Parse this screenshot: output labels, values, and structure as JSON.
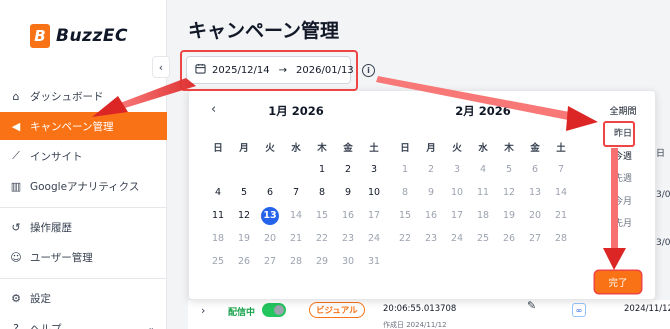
{
  "brand": {
    "logo_letter": "B",
    "name": "BuzzEC"
  },
  "sidebar": {
    "collapse": "‹",
    "items": [
      {
        "label": "ダッシュボード",
        "icon": "home-icon"
      },
      {
        "label": "キャンペーン管理",
        "icon": "megaphone-icon",
        "active": true
      },
      {
        "label": "インサイト",
        "icon": "trend-chart-icon"
      },
      {
        "label": "Googleアナリティクス",
        "icon": "bar-chart-icon"
      },
      {
        "label": "操作履歴",
        "icon": "history-icon"
      },
      {
        "label": "ユーザー管理",
        "icon": "users-icon"
      },
      {
        "label": "設定",
        "icon": "gear-icon"
      },
      {
        "label": "ヘルプ",
        "icon": "help-icon"
      }
    ]
  },
  "main": {
    "title": "キャンペーン管理",
    "date_range": {
      "start": "2025/12/14",
      "arrow": "→",
      "end": "2026/01/13"
    }
  },
  "picker": {
    "weekdays": [
      "日",
      "月",
      "火",
      "水",
      "木",
      "金",
      "土"
    ],
    "prev": "‹",
    "months": [
      {
        "title": "1月 2026",
        "days": [
          "",
          "",
          "",
          "",
          "1",
          "2",
          "3",
          "4",
          "5",
          "6",
          "7",
          "8",
          "9",
          "10",
          "11",
          "12",
          "13",
          "14",
          "15",
          "16",
          "17",
          "18",
          "19",
          "20",
          "21",
          "22",
          "23",
          "24",
          "25",
          "26",
          "27",
          "28",
          "29",
          "30",
          "31"
        ],
        "enabled_until": 13,
        "selected": 13
      },
      {
        "title": "2月 2026",
        "days": [
          "1",
          "2",
          "3",
          "4",
          "5",
          "6",
          "7",
          "8",
          "9",
          "10",
          "11",
          "12",
          "13",
          "14",
          "15",
          "16",
          "17",
          "18",
          "19",
          "20",
          "21",
          "22",
          "23",
          "24",
          "25",
          "26",
          "27",
          "28"
        ],
        "enabled_until": 0
      }
    ],
    "presets": [
      "全期間",
      "昨日",
      "今週",
      "先週",
      "今月",
      "先月"
    ],
    "done_label": "完了"
  },
  "table_row": {
    "chevron": "›",
    "status": "配信中",
    "type": "ビジュアル",
    "time": "20:06:55.013708",
    "created": "作成日 2024/11/12",
    "date": "2024/11/12",
    "edit": "✎",
    "platform": "∞"
  },
  "clipped": {
    "col1": "日",
    "col2": "3/0",
    "col3": "3/0"
  },
  "colors": {
    "accent": "#f97316",
    "highlight": "#ef4444",
    "selected": "#2563eb"
  }
}
